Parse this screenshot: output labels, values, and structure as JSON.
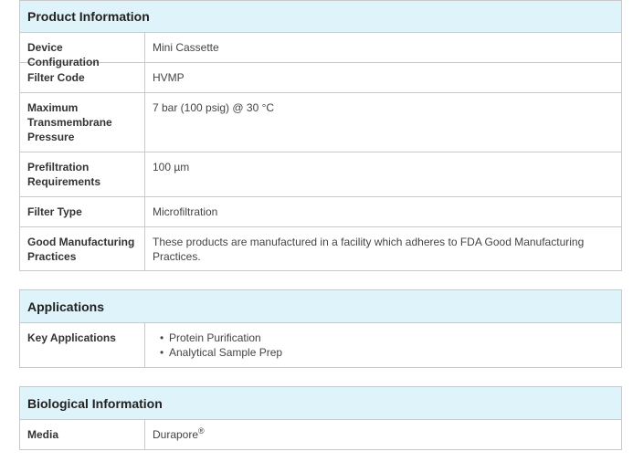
{
  "product_information": {
    "title": "Product Information",
    "rows": [
      {
        "label": "Device Configuration",
        "value": "Mini Cassette"
      },
      {
        "label": "Filter Code",
        "value": "HVMP"
      },
      {
        "label": "Maximum Transmembrane Pressure",
        "value": "7 bar (100 psig) @ 30 °C"
      },
      {
        "label": "Prefiltration Requirements",
        "value": "100 µm"
      },
      {
        "label": "Filter Type",
        "value": "Microfiltration"
      },
      {
        "label": "Good Manufacturing Practices",
        "value": "These products are manufactured in a facility which adheres to FDA Good Manufacturing Practices."
      }
    ]
  },
  "applications": {
    "title": "Applications",
    "label": "Key Applications",
    "items": [
      "Protein Purification",
      "Analytical Sample Prep"
    ]
  },
  "biological_information": {
    "title": "Biological Information",
    "label": "Media",
    "value": "Durapore",
    "superscript": "®"
  }
}
